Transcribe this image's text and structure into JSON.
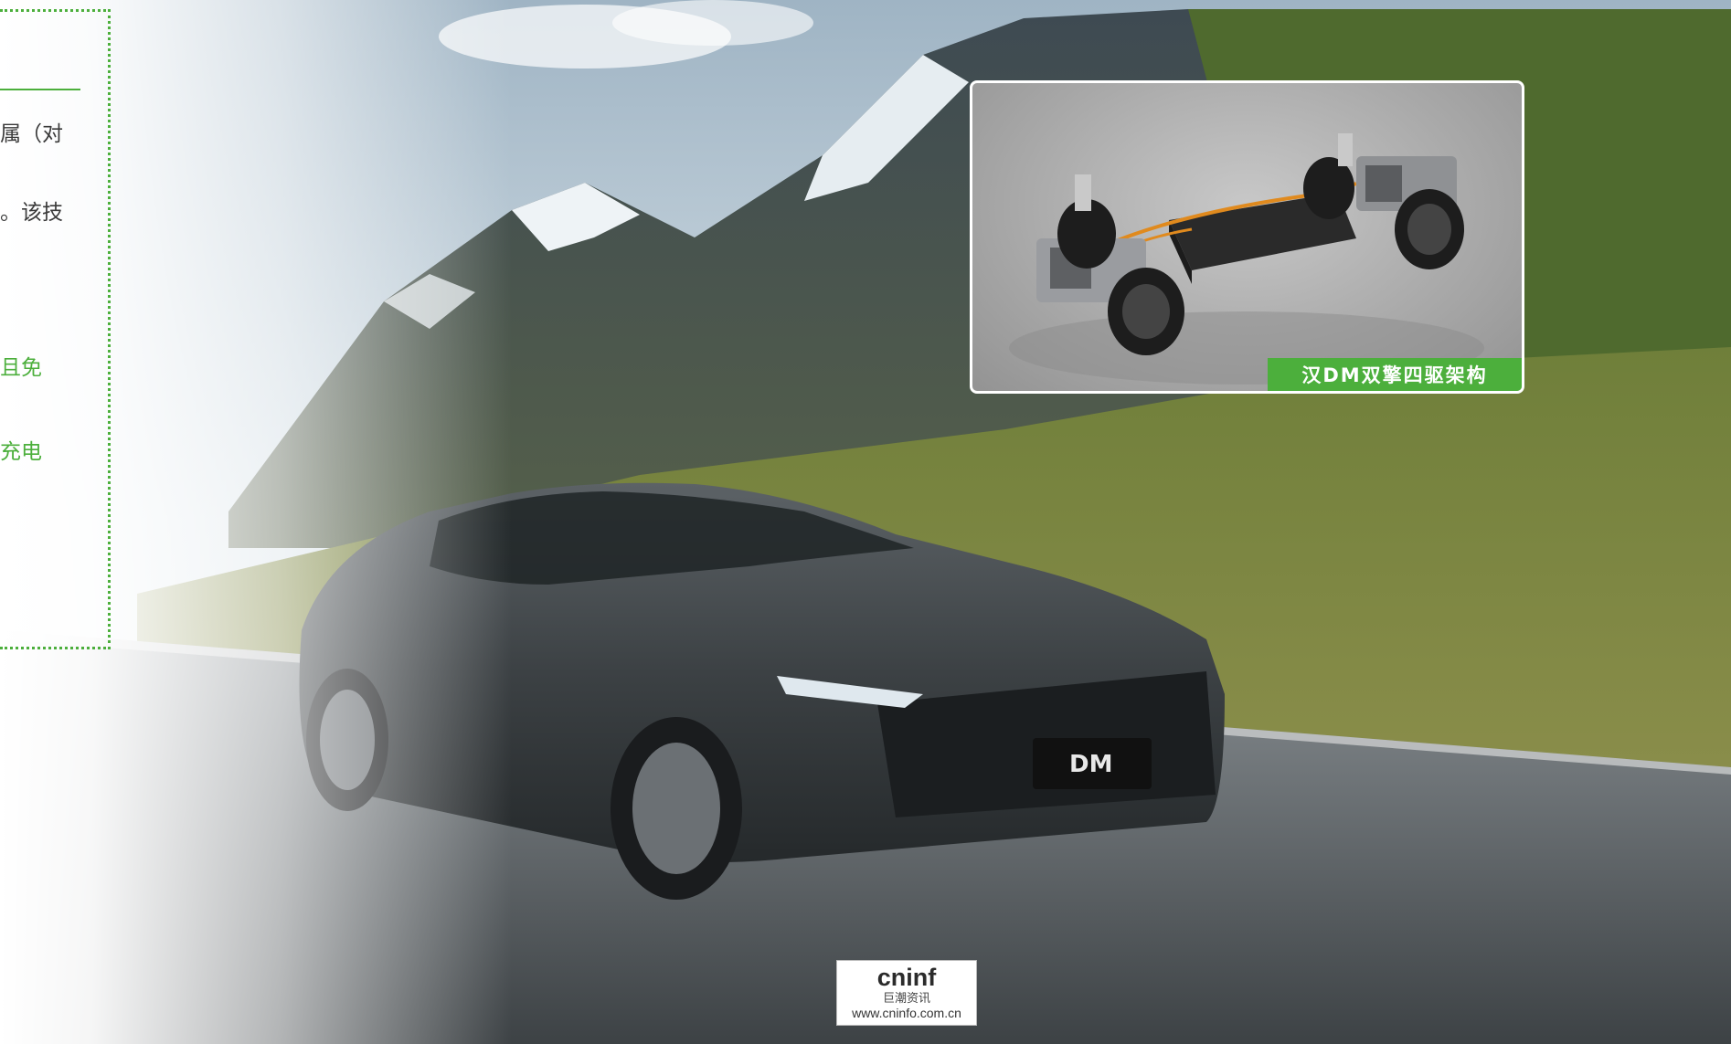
{
  "left_panel": {
    "fragments": [
      {
        "text": "属（对",
        "style": "dark"
      },
      {
        "text": "。该技",
        "style": "dark"
      },
      {
        "text": "且免",
        "style": "green"
      },
      {
        "text": "充电",
        "style": "green"
      }
    ]
  },
  "inset": {
    "caption": "汉DM双擎四驱架构"
  },
  "car_badge": {
    "text": "DM"
  },
  "watermark": {
    "brand": "cninf",
    "name": "巨潮资讯",
    "url": "www.cninfo.com.cn"
  },
  "colors": {
    "accent_green": "#4caf3c",
    "text_dark": "#3a3a3a"
  }
}
